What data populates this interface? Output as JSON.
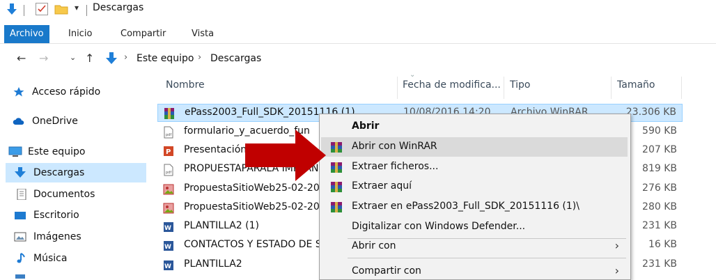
{
  "window": {
    "title": "Descargas"
  },
  "ribbon": {
    "tabs": [
      "Archivo",
      "Inicio",
      "Compartir",
      "Vista"
    ]
  },
  "address": {
    "crumbs": [
      "Este equipo",
      "Descargas"
    ]
  },
  "nav_pane": {
    "items": [
      {
        "label": "Acceso rápido",
        "icon": "star-icon"
      },
      {
        "label": "OneDrive",
        "icon": "cloud-icon"
      },
      {
        "label": "Este equipo",
        "icon": "computer-icon"
      },
      {
        "label": "Descargas",
        "icon": "download-folder-icon",
        "selected": true
      },
      {
        "label": "Documentos",
        "icon": "documents-icon"
      },
      {
        "label": "Escritorio",
        "icon": "desktop-icon"
      },
      {
        "label": "Imágenes",
        "icon": "pictures-icon"
      },
      {
        "label": "Música",
        "icon": "music-icon"
      }
    ]
  },
  "file_list": {
    "columns": [
      "Nombre",
      "Fecha de modifica...",
      "Tipo",
      "Tamaño"
    ],
    "rows": [
      {
        "name": "ePass2003_Full_SDK_20151116 (1)",
        "date": "10/08/2016 14:20",
        "type": "Archivo WinRAR",
        "size": "23.306 KB",
        "icon": "winrar-icon",
        "selected": true
      },
      {
        "name": "formulario_y_acuerdo_fun",
        "size": "590 KB",
        "icon": "pdf-icon"
      },
      {
        "name": "Presentación",
        "size": "207 KB",
        "icon": "powerpoint-icon"
      },
      {
        "name": "PROPUESTAPARALA IMPLAN",
        "size": "819 KB",
        "icon": "pdf-icon"
      },
      {
        "name": "PropuestaSitioWeb25-02-201",
        "size": "276 KB",
        "icon": "image-doc-icon"
      },
      {
        "name": "PropuestaSitioWeb25-02-201",
        "size": "280 KB",
        "icon": "image-doc-icon"
      },
      {
        "name": "PLANTILLA2 (1)",
        "size": "231 KB",
        "icon": "word-icon"
      },
      {
        "name": "CONTACTOS Y ESTADO DE S",
        "size": "16 KB",
        "icon": "word-icon"
      },
      {
        "name": "PLANTILLA2",
        "size": "231 KB",
        "icon": "word-icon"
      }
    ]
  },
  "context_menu": {
    "items": [
      {
        "label": "Abrir",
        "bold": true
      },
      {
        "label": "Abrir con WinRAR",
        "icon": "winrar-icon",
        "highlighted": true
      },
      {
        "label": "Extraer ficheros...",
        "icon": "winrar-icon"
      },
      {
        "label": "Extraer aquí",
        "icon": "winrar-icon"
      },
      {
        "label": "Extraer en ePass2003_Full_SDK_20151116 (1)\\",
        "icon": "winrar-icon"
      },
      {
        "label": "Digitalizar con Windows Defender..."
      },
      {
        "label": "Abrir con",
        "submenu": true
      },
      {
        "label": "Compartir con",
        "submenu": true
      }
    ]
  },
  "colors": {
    "accent": "#1979ca",
    "selection": "#cce8ff",
    "arrow": "#c00000"
  }
}
